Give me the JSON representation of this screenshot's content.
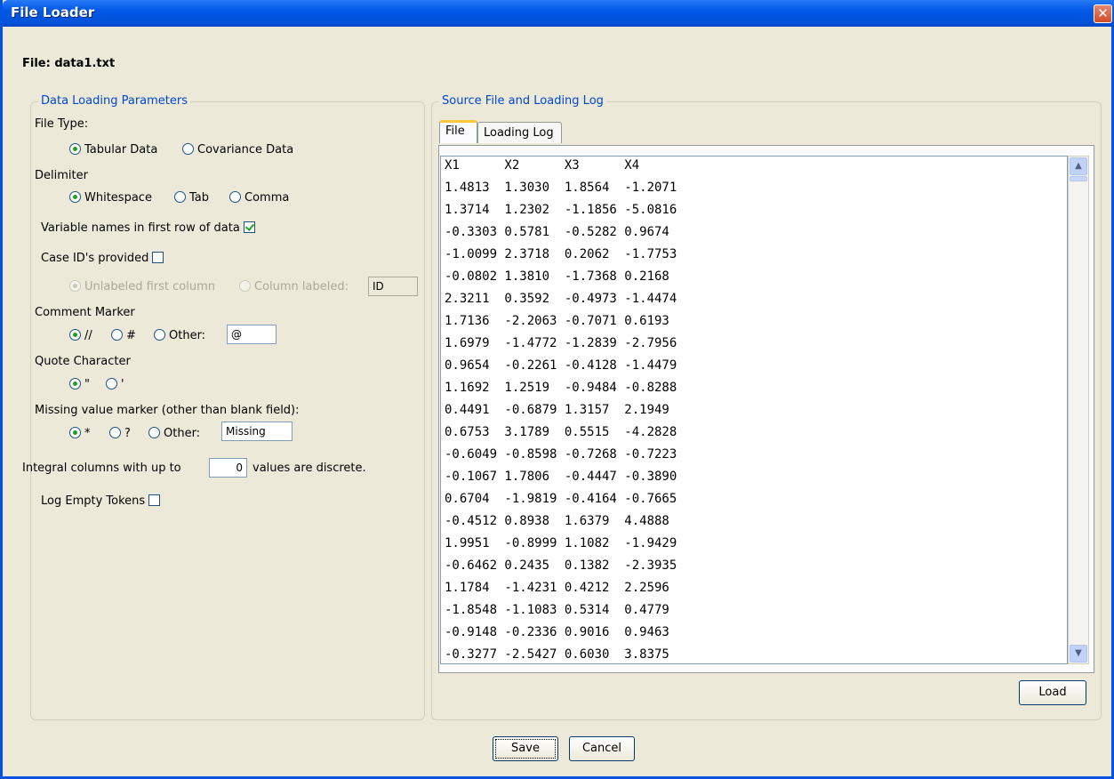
{
  "window": {
    "title": "File Loader",
    "close_label": "✕"
  },
  "file_label": "File: data1.txt",
  "left_panel": {
    "title": "Data Loading Parameters",
    "file_type": {
      "label": "File Type:",
      "options": [
        "Tabular Data",
        "Covariance Data"
      ],
      "selected": "Tabular Data"
    },
    "delimiter": {
      "label": "Delimiter",
      "options": [
        "Whitespace",
        "Tab",
        "Comma"
      ],
      "selected": "Whitespace"
    },
    "var_names": {
      "label": "Variable names in first row of data",
      "checked": true
    },
    "case_ids": {
      "label": "Case ID's provided",
      "checked": false
    },
    "case_id_options": {
      "unlabeled": "Unlabeled first column",
      "labeled": "Column labeled:",
      "labeled_value": "ID"
    },
    "comment_marker": {
      "label": "Comment Marker",
      "options": [
        "//",
        "#",
        "Other:"
      ],
      "selected": "//",
      "other_value": "@"
    },
    "quote_char": {
      "label": "Quote Character",
      "options": [
        "\"",
        "'"
      ],
      "selected": "\""
    },
    "missing": {
      "label": "Missing value marker (other than blank field):",
      "options": [
        "*",
        "?",
        "Other:"
      ],
      "selected": "*",
      "other_value": "Missing"
    },
    "integral": {
      "prefix": "Integral columns with up to",
      "value": "0",
      "suffix": "values are discrete."
    },
    "log_empty": {
      "label": "Log Empty Tokens",
      "checked": false
    }
  },
  "right_panel": {
    "title": "Source File and Loading Log",
    "tabs": [
      "File",
      "Loading Log"
    ],
    "active_tab": "File",
    "lines": [
      "X1      X2      X3      X4",
      "1.4813  1.3030  1.8564  -1.2071",
      "1.3714  1.2302  -1.1856 -5.0816",
      "-0.3303 0.5781  -0.5282 0.9674",
      "-1.0099 2.3718  0.2062  -1.7753",
      "-0.0802 1.3810  -1.7368 0.2168",
      "2.3211  0.3592  -0.4973 -1.4474",
      "1.7136  -2.2063 -0.7071 0.6193",
      "1.6979  -1.4772 -1.2839 -2.7956",
      "0.9654  -0.2261 -0.4128 -1.4479",
      "1.1692  1.2519  -0.9484 -0.8288",
      "0.4491  -0.6879 1.3157  2.1949",
      "0.6753  3.1789  0.5515  -4.2828",
      "-0.6049 -0.8598 -0.7268 -0.7223",
      "-0.1067 1.7806  -0.4447 -0.3890",
      "0.6704  -1.9819 -0.4164 -0.7665",
      "-0.4512 0.8938  1.6379  4.4888",
      "1.9951  -0.8999 1.1082  -1.9429",
      "-0.6462 0.2435  0.1382  -2.3935",
      "1.1784  -1.4231 0.4212  2.2596",
      "-1.8548 -1.1083 0.5314  0.4779",
      "-0.9148 -0.2336 0.9016  0.9463",
      "-0.3277 -2.5427 0.6030  3.8375"
    ],
    "load_label": "Load"
  },
  "footer": {
    "save_label": "Save",
    "cancel_label": "Cancel"
  }
}
